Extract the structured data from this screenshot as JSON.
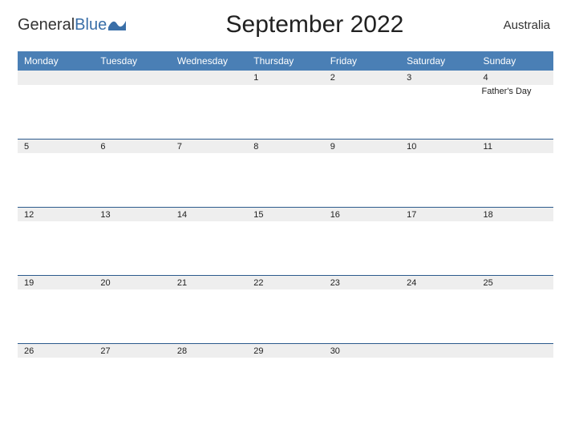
{
  "header": {
    "logo_general": "General",
    "logo_blue": "Blue",
    "title": "September 2022",
    "region": "Australia"
  },
  "days": [
    "Monday",
    "Tuesday",
    "Wednesday",
    "Thursday",
    "Friday",
    "Saturday",
    "Sunday"
  ],
  "weeks": [
    {
      "numbers": [
        "",
        "",
        "",
        "1",
        "2",
        "3",
        "4"
      ],
      "events": [
        "",
        "",
        "",
        "",
        "",
        "",
        "Father's Day"
      ]
    },
    {
      "numbers": [
        "5",
        "6",
        "7",
        "8",
        "9",
        "10",
        "11"
      ],
      "events": [
        "",
        "",
        "",
        "",
        "",
        "",
        ""
      ]
    },
    {
      "numbers": [
        "12",
        "13",
        "14",
        "15",
        "16",
        "17",
        "18"
      ],
      "events": [
        "",
        "",
        "",
        "",
        "",
        "",
        ""
      ]
    },
    {
      "numbers": [
        "19",
        "20",
        "21",
        "22",
        "23",
        "24",
        "25"
      ],
      "events": [
        "",
        "",
        "",
        "",
        "",
        "",
        ""
      ]
    },
    {
      "numbers": [
        "26",
        "27",
        "28",
        "29",
        "30",
        "",
        ""
      ],
      "events": [
        "",
        "",
        "",
        "",
        "",
        "",
        ""
      ]
    }
  ]
}
